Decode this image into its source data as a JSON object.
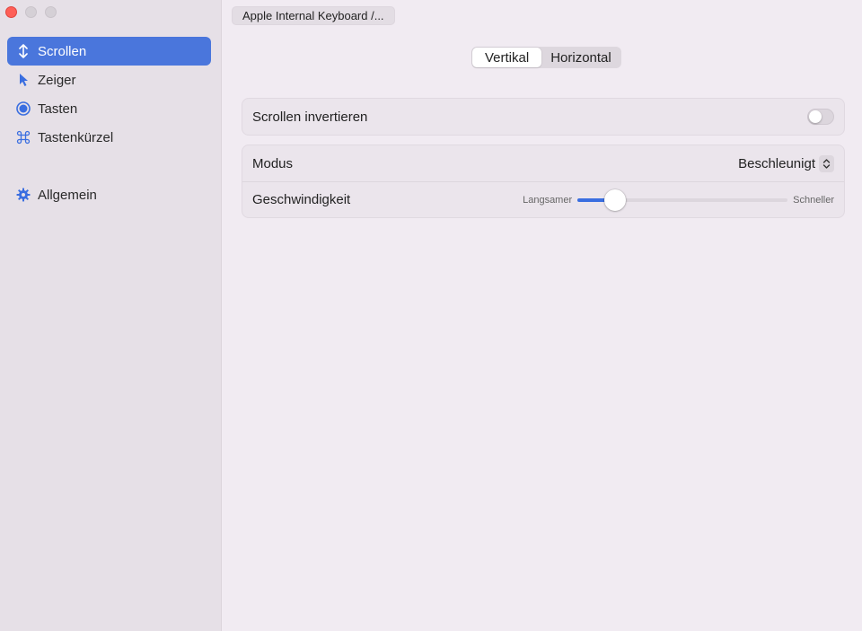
{
  "window": {
    "traffic_lights": [
      "close",
      "minimize",
      "zoom"
    ]
  },
  "sidebar": {
    "items": [
      {
        "label": "Scrollen",
        "icon": "scroll-arrows-icon",
        "active": true
      },
      {
        "label": "Zeiger",
        "icon": "pointer-icon",
        "active": false
      },
      {
        "label": "Tasten",
        "icon": "button-circle-icon",
        "active": false
      },
      {
        "label": "Tastenkürzel",
        "icon": "command-key-icon",
        "active": false
      }
    ],
    "footer_items": [
      {
        "label": "Allgemein",
        "icon": "gear-icon",
        "active": false
      }
    ]
  },
  "toolbar": {
    "device_label": "Apple Internal Keyboard /..."
  },
  "segmented": {
    "options": [
      "Vertikal",
      "Horizontal"
    ],
    "selected": "Vertikal"
  },
  "settings": {
    "invert": {
      "label": "Scrollen invertieren",
      "enabled": false
    },
    "mode": {
      "label": "Modus",
      "value": "Beschleunigt"
    },
    "speed": {
      "label": "Geschwindigkeit",
      "min_label": "Langsamer",
      "max_label": "Schneller",
      "value_fraction": 0.14
    }
  },
  "colors": {
    "accent": "#4a76dc",
    "slider_fill": "#3a6ee0",
    "close_red": "#fe5f57"
  }
}
